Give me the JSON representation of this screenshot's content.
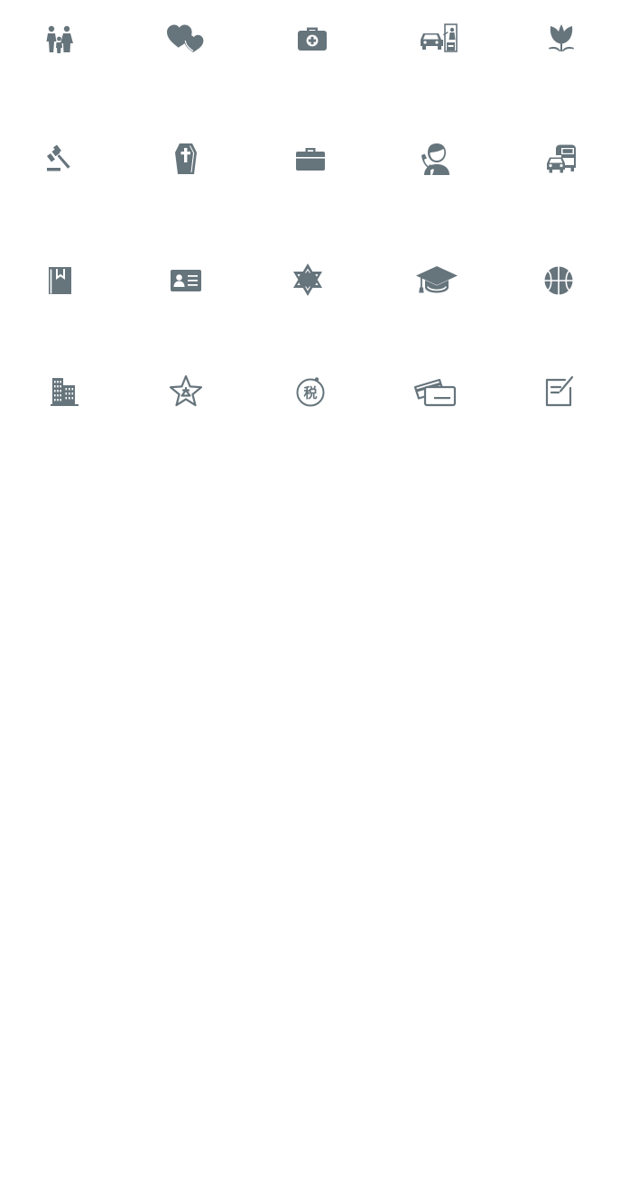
{
  "theme": {
    "icon_color": "#66747c",
    "background": "#ffffff"
  },
  "icons": [
    {
      "row": 1,
      "col": 1,
      "name": "family-icon"
    },
    {
      "row": 1,
      "col": 2,
      "name": "hearts-icon"
    },
    {
      "row": 1,
      "col": 3,
      "name": "medical-kit-icon"
    },
    {
      "row": 1,
      "col": 4,
      "name": "drive-thru-icon"
    },
    {
      "row": 1,
      "col": 5,
      "name": "tulip-icon"
    },
    {
      "row": 2,
      "col": 1,
      "name": "gavel-icon"
    },
    {
      "row": 2,
      "col": 2,
      "name": "coffin-icon"
    },
    {
      "row": 2,
      "col": 3,
      "name": "briefcase-icon"
    },
    {
      "row": 2,
      "col": 4,
      "name": "call-center-agent-icon"
    },
    {
      "row": 2,
      "col": 5,
      "name": "car-and-bus-icon"
    },
    {
      "row": 3,
      "col": 1,
      "name": "bookmarked-book-icon"
    },
    {
      "row": 3,
      "col": 2,
      "name": "id-card-icon"
    },
    {
      "row": 3,
      "col": 3,
      "name": "star-of-david-icon"
    },
    {
      "row": 3,
      "col": 4,
      "name": "graduation-cap-icon"
    },
    {
      "row": 3,
      "col": 5,
      "name": "basketball-icon"
    },
    {
      "row": 4,
      "col": 1,
      "name": "office-buildings-icon"
    },
    {
      "row": 4,
      "col": 2,
      "name": "star-outline-icon"
    },
    {
      "row": 4,
      "col": 3,
      "name": "tax-icon"
    },
    {
      "row": 4,
      "col": 4,
      "name": "credit-cards-icon"
    },
    {
      "row": 4,
      "col": 5,
      "name": "edit-note-icon"
    }
  ],
  "tax_icon": {
    "glyph": "税"
  }
}
